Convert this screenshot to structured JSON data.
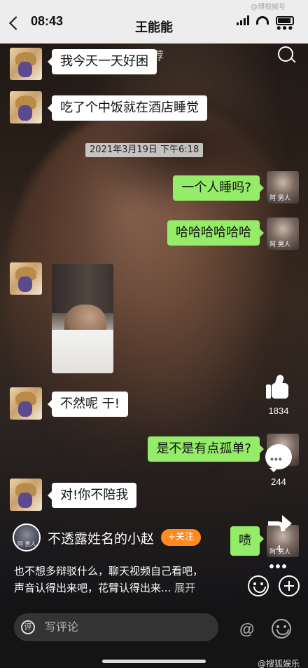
{
  "status_bar": {
    "time": "08:43"
  },
  "chat": {
    "title": "王能能",
    "messages": [
      {
        "side": "left",
        "text": "我今天一天好困"
      },
      {
        "side": "left",
        "text": "吃了个中饭就在酒店睡觉"
      },
      {
        "side": "right",
        "text": "一个人睡吗?"
      },
      {
        "side": "right",
        "text": "哈哈哈哈哈哈"
      },
      {
        "side": "left",
        "text": "不然呢 干!"
      },
      {
        "side": "right",
        "text": "是不是有点孤单?"
      },
      {
        "side": "left",
        "text": "对!你不陪我"
      },
      {
        "side": "right",
        "text": "啧"
      }
    ],
    "timestamp": "2021年3月19日 下午6:18",
    "right_avatar_tag": "阿 男人"
  },
  "feed": {
    "recommend_label": "推荐",
    "like_count": "1834",
    "comment_count": "244",
    "share_count": "4",
    "author": {
      "name": "不透露姓名的小赵",
      "follow_label": "+关注",
      "avatar_tag": "阿 男人"
    },
    "caption_line1": "也不想多辩驳什么，聊天视频自己看吧，",
    "caption_line2": "声音认得出来吧，花臂认得出来...",
    "caption_expand": "展开"
  },
  "bottom": {
    "comment_badge": "评",
    "comment_placeholder": "写评论",
    "at_symbol": "@",
    "watermark": "@搜狐娱乐",
    "top_watermark": "@博视频号"
  }
}
